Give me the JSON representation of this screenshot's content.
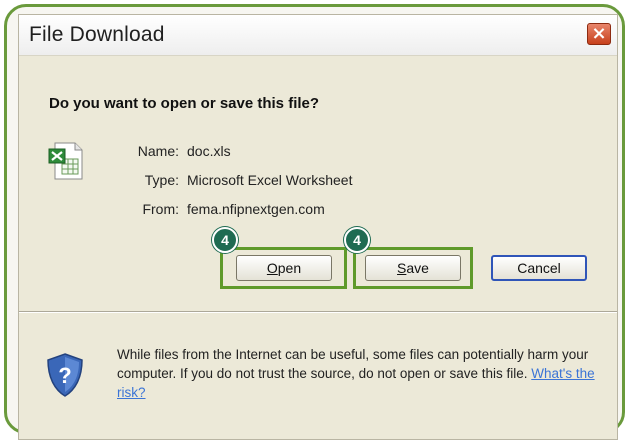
{
  "dialog": {
    "title": "File Download",
    "close_label": "×",
    "question": "Do you want to open or save this file?"
  },
  "file_info": {
    "name_label": "Name:",
    "name_value": "doc.xls",
    "type_label": "Type:",
    "type_value": "Microsoft Excel Worksheet",
    "from_label": "From:",
    "from_value": "fema.nfipnextgen.com",
    "icon": "excel-file-icon"
  },
  "buttons": {
    "open_label": "Open",
    "save_label": "Save",
    "cancel_label": "Cancel"
  },
  "callouts": {
    "open_step": "4",
    "save_step": "4",
    "highlight_color": "#5f9a2a",
    "badge_color": "#1f6b52"
  },
  "warning": {
    "text": "While files from the Internet can be useful, some files can potentially harm your computer. If you do not trust the source, do not open or save this file.",
    "link_text": "What's the risk?",
    "icon": "shield-question-icon"
  },
  "colors": {
    "frame": "#6a9a3c",
    "dialog_bg": "#ece9d8",
    "close_button": "#c7401c",
    "link": "#3b74d6"
  }
}
